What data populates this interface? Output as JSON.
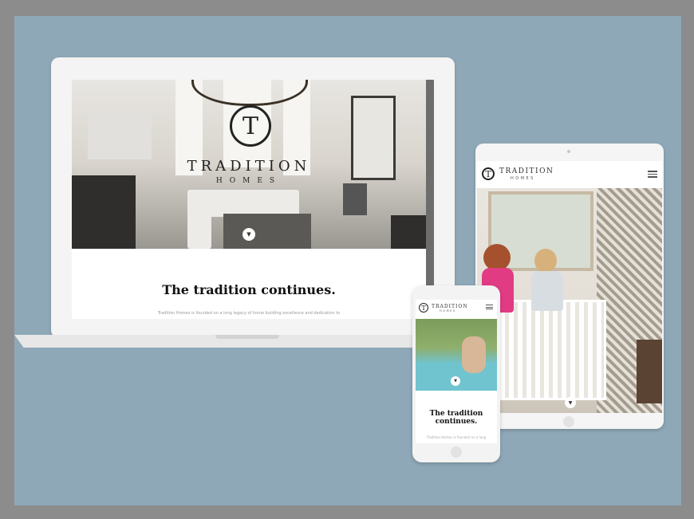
{
  "brand": {
    "name": "TRADITION",
    "sub": "HOMES",
    "monogram": "T"
  },
  "desktop": {
    "tagline": "The tradition continues.",
    "blurb": "Tradition Homes is founded on a long legacy of home building excellence and dedication to"
  },
  "tablet": {
    "brand_name": "TRADITION",
    "brand_sub": "HOMES"
  },
  "mobile": {
    "brand_name": "TRADITION",
    "brand_sub": "HOMES",
    "tagline_line1": "The tradition",
    "tagline_line2": "continues.",
    "blurb": "Tradition Homes is founded on a long"
  },
  "icons": {
    "scroll_down": "chevron-down-icon",
    "menu": "hamburger-menu-icon",
    "logo": "monogram-logo-icon"
  },
  "colors": {
    "background": "#8fa8b8",
    "border": "#8c8c8c",
    "text_dark": "#111111",
    "text_muted": "#999999"
  }
}
